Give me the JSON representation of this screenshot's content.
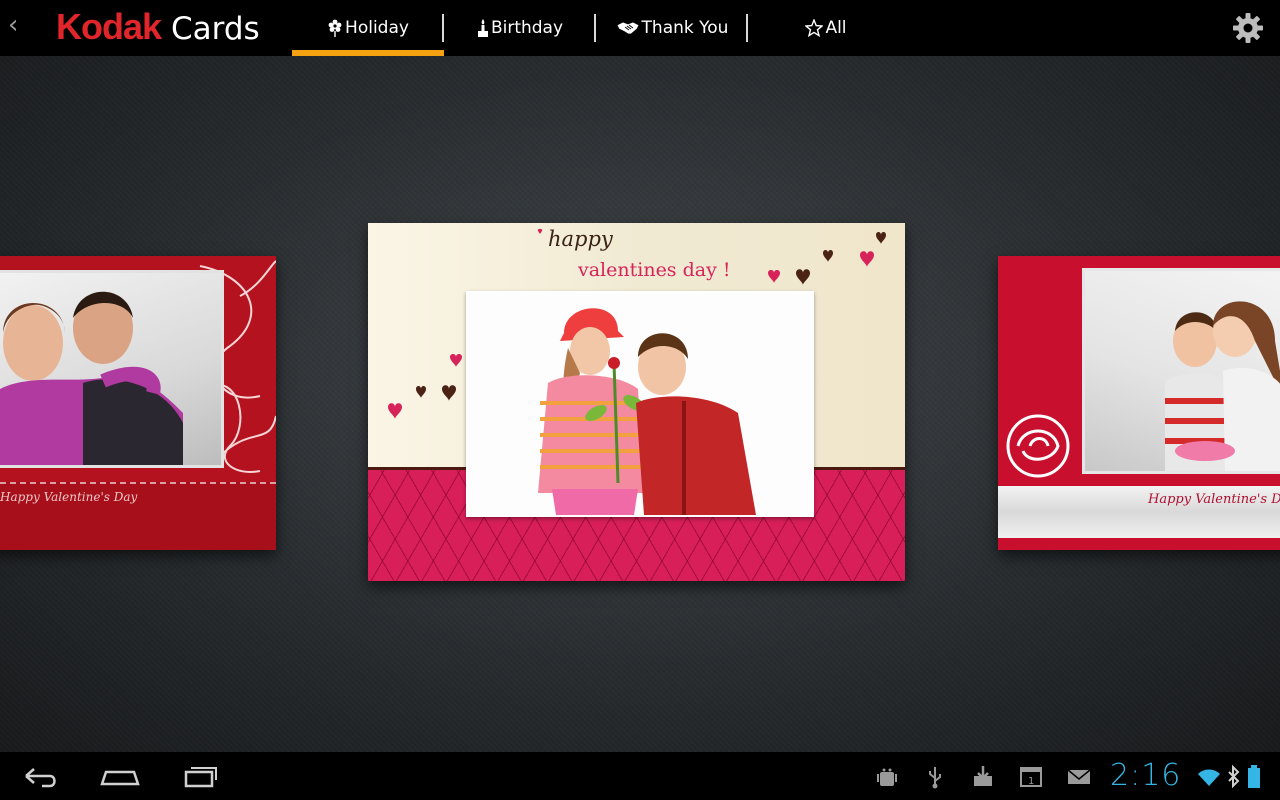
{
  "app": {
    "brand_name": "Kodak",
    "title": "Cards"
  },
  "tabs": [
    {
      "label": "Holiday",
      "icon": "flower-icon",
      "selected": true
    },
    {
      "label": "Birthday",
      "icon": "candle-icon",
      "selected": false
    },
    {
      "label": "Thank You",
      "icon": "handshake-icon",
      "selected": false
    },
    {
      "label": "All",
      "icon": "star-icon",
      "selected": false
    }
  ],
  "cards": {
    "left": {
      "caption": "Happy Valentine's Day"
    },
    "center": {
      "greeting_line1": "happy",
      "greeting_line2": "valentines day !"
    },
    "right": {
      "caption": "Happy Valentine's Day"
    }
  },
  "status_bar": {
    "time": "2:16",
    "icons": [
      "android-debug-icon",
      "usb-icon",
      "download-icon",
      "calendar-icon",
      "mail-icon",
      "wifi-icon",
      "bluetooth-icon",
      "battery-icon"
    ]
  },
  "colors": {
    "brand_red": "#e0262a",
    "tab_indicator": "#f4a20f",
    "clock_blue": "#35b5e5"
  }
}
